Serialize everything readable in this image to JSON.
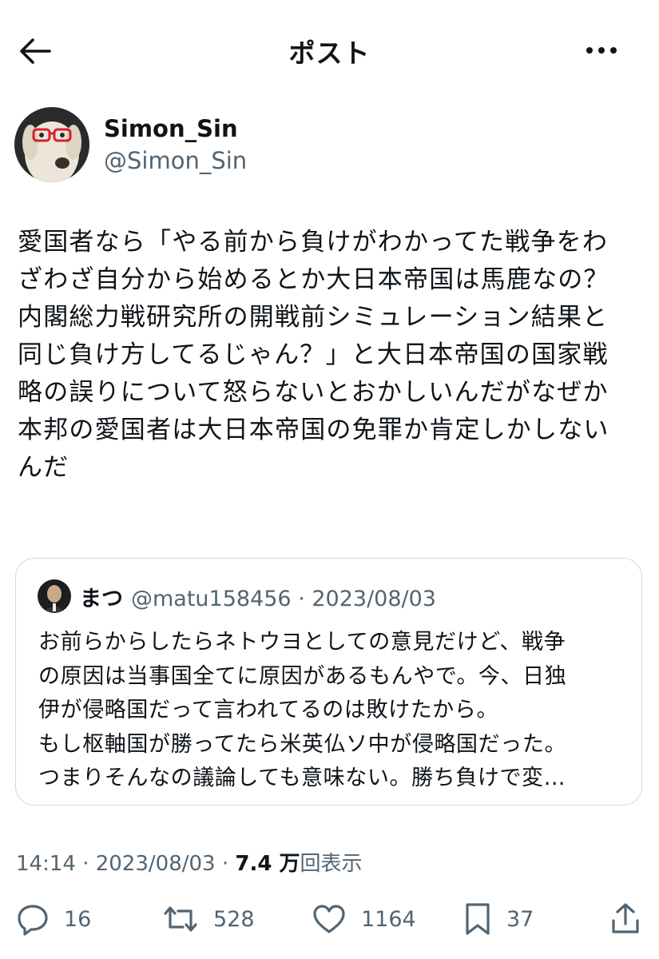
{
  "header": {
    "title": "ポスト",
    "back_icon": "arrow-left-icon",
    "more_icon": "more-horizontal-icon"
  },
  "author": {
    "display_name": "Simon_Sin",
    "handle": "@Simon_Sin"
  },
  "post": {
    "text": "愛国者なら「やる前から負けがわかってた戦争をわ\nざわざ自分から始めるとか大日本帝国は馬鹿なの？\n内閣総力戦研究所の開戦前シミュレーション結果と\n同じ負け方してるじゃん？」と大日本帝国の国家戦\n略の誤りについて怒らないとおかしいんだがなぜか\n本邦の愛国者は大日本帝国の免罪か肯定しかしない\nんだ"
  },
  "quote": {
    "display_name": "まつ",
    "meta": "@matu158456 · 2023/08/03",
    "text": "お前らからしたらネトウヨとしての意見だけど、戦争\nの原因は当事国全てに原因があるもんやで。今、日独\n伊が侵略国だって言われてるのは敗けたから。\nもし枢軸国が勝ってたら米英仏ソ中が侵略国だった。\nつまりそんなの議論しても意味ない。勝ち負けで変…"
  },
  "meta": {
    "timestamp": "14:14 · 2023/08/03 · ",
    "views_count": "7.4 万",
    "views_label": "回表示"
  },
  "actions": {
    "reply_count": "16",
    "repost_count": "528",
    "like_count": "1164",
    "bookmark_count": "37"
  },
  "colors": {
    "text": "#0f1419",
    "secondary": "#536471",
    "border": "#cfd9de"
  }
}
